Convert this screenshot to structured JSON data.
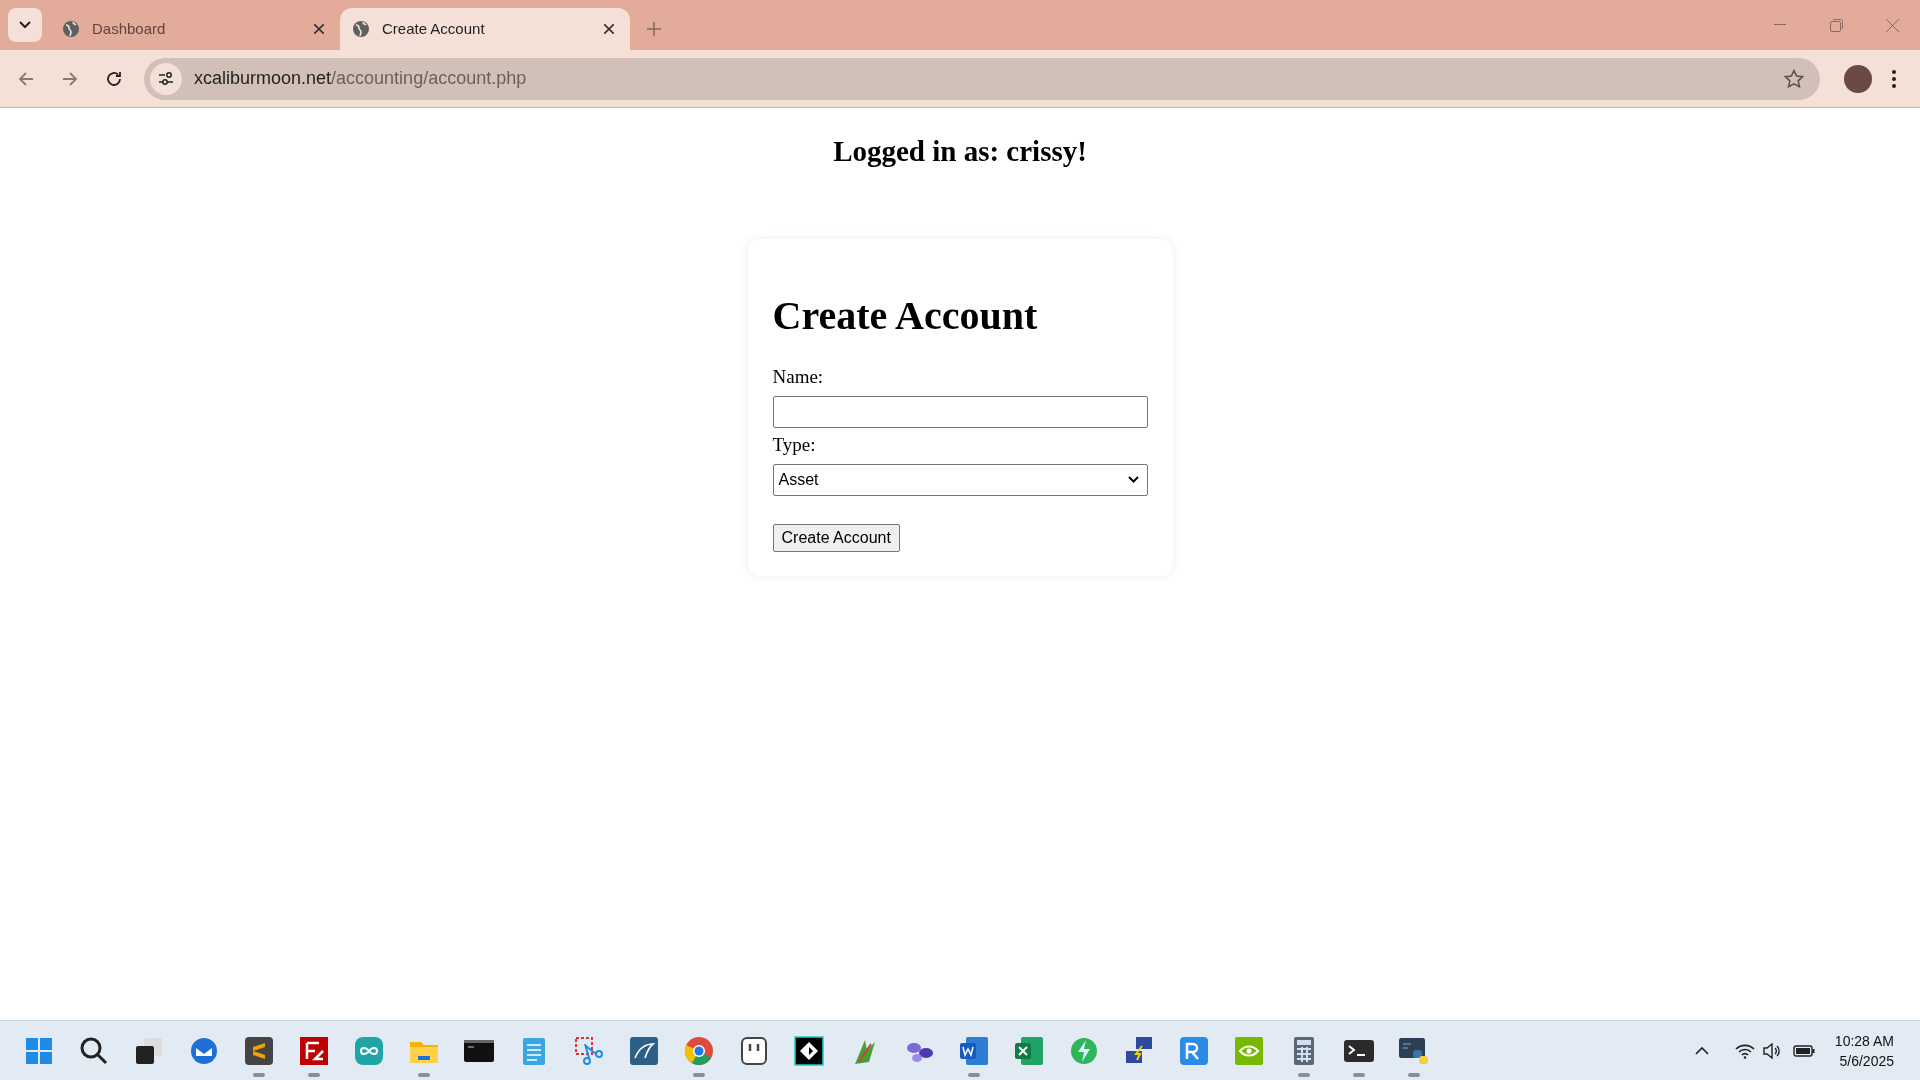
{
  "browser": {
    "tabs": [
      {
        "title": "Dashboard",
        "selected": false
      },
      {
        "title": "Create Account",
        "selected": true
      }
    ],
    "address": {
      "host": "xcaliburmoon.net",
      "path": "/accounting/account.php"
    }
  },
  "page": {
    "greeting": "Logged in as: crissy!",
    "form": {
      "title": "Create Account",
      "fields": [
        {
          "kind": "text",
          "label": "Name:"
        },
        {
          "kind": "select",
          "label": "Type:",
          "value": "Asset"
        }
      ],
      "submit": "Create Account"
    }
  },
  "taskbar": {
    "apps": [
      {
        "kind": "windows",
        "running": false
      },
      {
        "kind": "search",
        "running": false
      },
      {
        "kind": "taskview",
        "running": false
      },
      {
        "kind": "mail",
        "running": false
      },
      {
        "kind": "sublime",
        "running": true
      },
      {
        "kind": "filezilla",
        "running": true
      },
      {
        "kind": "arduino",
        "running": false
      },
      {
        "kind": "folder",
        "running": true
      },
      {
        "kind": "console",
        "running": false
      },
      {
        "kind": "notepad",
        "running": false
      },
      {
        "kind": "snip",
        "running": false
      },
      {
        "kind": "database",
        "running": false
      },
      {
        "kind": "browser",
        "running": true
      },
      {
        "kind": "pixel",
        "running": false
      },
      {
        "kind": "gamemaker",
        "running": false
      },
      {
        "kind": "sprout",
        "running": false
      },
      {
        "kind": "bubbles",
        "running": false
      },
      {
        "kind": "word",
        "running": true
      },
      {
        "kind": "excel",
        "running": false
      },
      {
        "kind": "sync",
        "running": false
      },
      {
        "kind": "network",
        "running": false
      },
      {
        "kind": "vnc",
        "running": false
      },
      {
        "kind": "gpu",
        "running": false
      },
      {
        "kind": "calculator",
        "running": true
      },
      {
        "kind": "terminal",
        "running": true
      },
      {
        "kind": "python",
        "running": true
      }
    ],
    "clock": {
      "time": "10:28 AM",
      "date": "5/6/2025"
    }
  }
}
